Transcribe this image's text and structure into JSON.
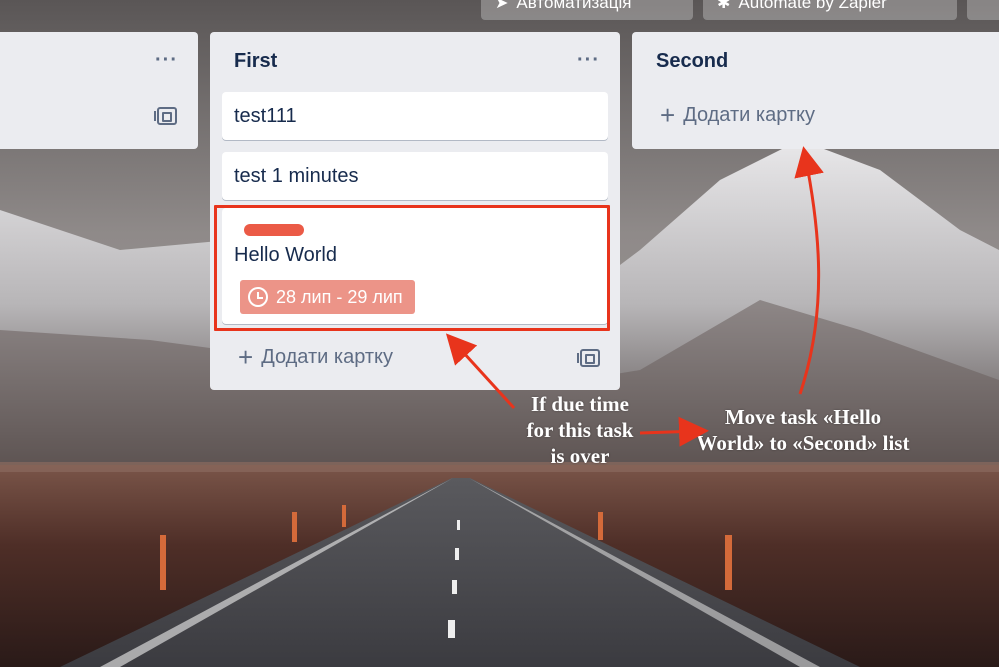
{
  "header": {
    "automation_label": "Автоматизація",
    "zapier_label": "Automate by Zapier"
  },
  "lists": [
    {
      "title": "",
      "cards": []
    },
    {
      "title": "First",
      "cards": [
        {
          "title": "test111"
        },
        {
          "title": "test 1 minutes"
        },
        {
          "title": "Hello World",
          "label_color": "#eb5a46",
          "due": "28 лип - 29 лип"
        }
      ],
      "add_card_label": "Додати картку"
    },
    {
      "title": "Second",
      "cards": [],
      "add_card_label": "Додати картку"
    }
  ],
  "annotations": {
    "due_note_lines": [
      "If due time",
      "for this task",
      "is over"
    ],
    "move_note_lines": [
      "Move task «Hello",
      "World» to «Second» list"
    ],
    "accent_color": "#e8341c"
  },
  "icons": {
    "menu": "more-horizontal-icon",
    "template": "card-template-icon",
    "plus": "plus-icon",
    "clock": "clock-icon"
  }
}
